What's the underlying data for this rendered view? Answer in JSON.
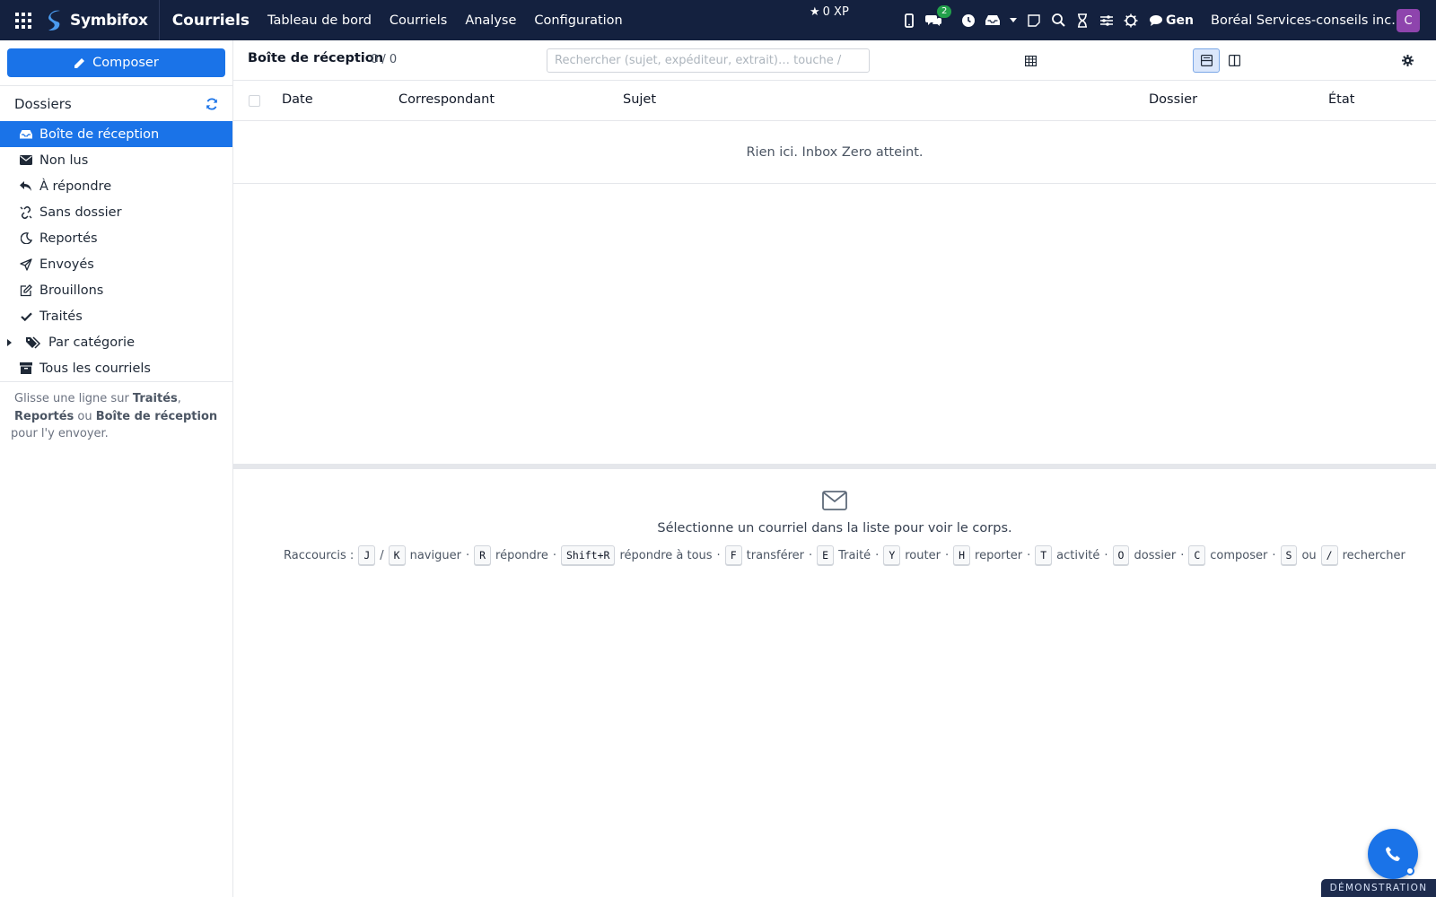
{
  "topbar": {
    "brand": "Symbifox",
    "app_title": "Courriels",
    "nav": [
      "Tableau de bord",
      "Courriels",
      "Analyse",
      "Configuration"
    ],
    "xp": "0 XP",
    "chat_badge": "2",
    "gen_label": "Gen",
    "company": "Boréal Services-conseils inc.",
    "avatar_initial": "C",
    "colors": {
      "bar": "#14213f",
      "badge": "#22a04b",
      "avatar": "#8e44ad"
    }
  },
  "sidebar": {
    "compose_label": "Composer",
    "folders_title": "Dossiers",
    "items": [
      {
        "label": "Boîte de réception",
        "icon": "inbox-icon",
        "active": true
      },
      {
        "label": "Non lus",
        "icon": "envelope-icon"
      },
      {
        "label": "À répondre",
        "icon": "reply-icon"
      },
      {
        "label": "Sans dossier",
        "icon": "unlink-icon"
      },
      {
        "label": "Reportés",
        "icon": "moon-icon"
      },
      {
        "label": "Envoyés",
        "icon": "paper-plane-icon"
      },
      {
        "label": "Brouillons",
        "icon": "edit-icon"
      },
      {
        "label": "Traités",
        "icon": "check-icon"
      },
      {
        "label": "Par catégorie",
        "icon": "tags-icon"
      },
      {
        "label": "Tous les courriels",
        "icon": "archive-icon"
      }
    ],
    "note": {
      "prefix": "Glisse une ligne sur ",
      "b1": "Traités",
      "sep1": ", ",
      "b2": "Reportés",
      "sep2": " ou ",
      "b3": "Boîte de réception",
      "suffix": " pour l'y envoyer."
    }
  },
  "main": {
    "title": "Boîte de réception",
    "count": "0 / 0",
    "search_placeholder": "Rechercher (sujet, expéditeur, extrait)… touche /",
    "columns": [
      "Date",
      "Correspondant",
      "Sujet",
      "Dossier",
      "État"
    ],
    "empty_message": "Rien ici. Inbox Zero atteint.",
    "preview_message": "Sélectionne un courriel dans la liste pour voir le corps.",
    "shortcuts_label": "Raccourcis :",
    "shortcuts": [
      {
        "keys": [
          "J",
          "K"
        ],
        "action": "naviguer"
      },
      {
        "keys": [
          "R"
        ],
        "action": "répondre"
      },
      {
        "keys": [
          "Shift+R"
        ],
        "action": "répondre à tous"
      },
      {
        "keys": [
          "F"
        ],
        "action": "transférer"
      },
      {
        "keys": [
          "E"
        ],
        "action": "Traité"
      },
      {
        "keys": [
          "Y"
        ],
        "action": "router"
      },
      {
        "keys": [
          "H"
        ],
        "action": "reporter"
      },
      {
        "keys": [
          "T"
        ],
        "action": "activité"
      },
      {
        "keys": [
          "O"
        ],
        "action": "dossier"
      },
      {
        "keys": [
          "C"
        ],
        "action": "composer"
      },
      {
        "keys": [
          "S",
          "/"
        ],
        "action": "rechercher"
      }
    ],
    "shortcut_or": "ou",
    "accent": "#1a73e8"
  },
  "footer": {
    "demo_label": "DÉMONSTRATION"
  }
}
